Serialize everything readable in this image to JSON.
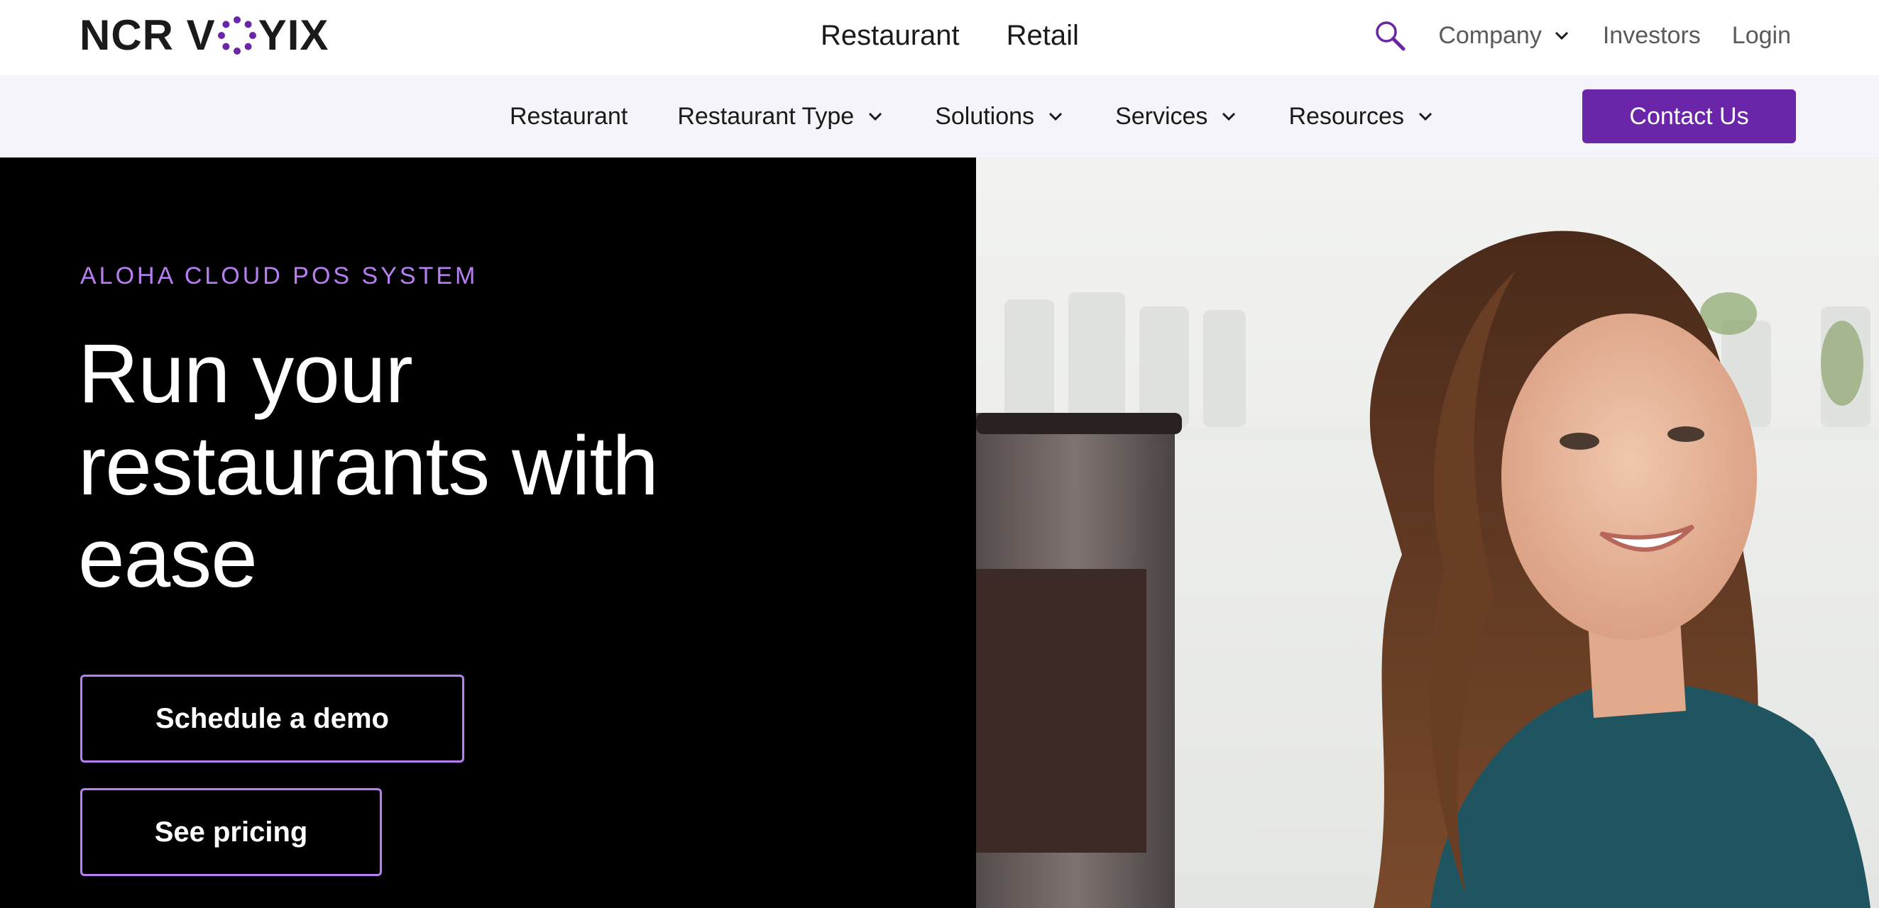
{
  "brand": {
    "logo_text_left": "NCR V",
    "logo_text_right": "YIX",
    "accent": "#6a25a8",
    "accent_light": "#b77ff2"
  },
  "top_nav": {
    "links": [
      "Restaurant",
      "Retail"
    ],
    "search_icon": "search-icon",
    "company_label": "Company",
    "investors_label": "Investors",
    "login_label": "Login"
  },
  "sub_nav": {
    "items": [
      {
        "label": "Restaurant",
        "has_dropdown": false
      },
      {
        "label": "Restaurant Type",
        "has_dropdown": true
      },
      {
        "label": "Solutions",
        "has_dropdown": true
      },
      {
        "label": "Services",
        "has_dropdown": true
      },
      {
        "label": "Resources",
        "has_dropdown": true
      }
    ],
    "contact_label": "Contact Us"
  },
  "hero": {
    "eyebrow": "ALOHA CLOUD POS SYSTEM",
    "headline": "Run your restaurants with ease",
    "demo_button": "Schedule a demo",
    "pricing_button": "See pricing",
    "background": "#000000"
  }
}
